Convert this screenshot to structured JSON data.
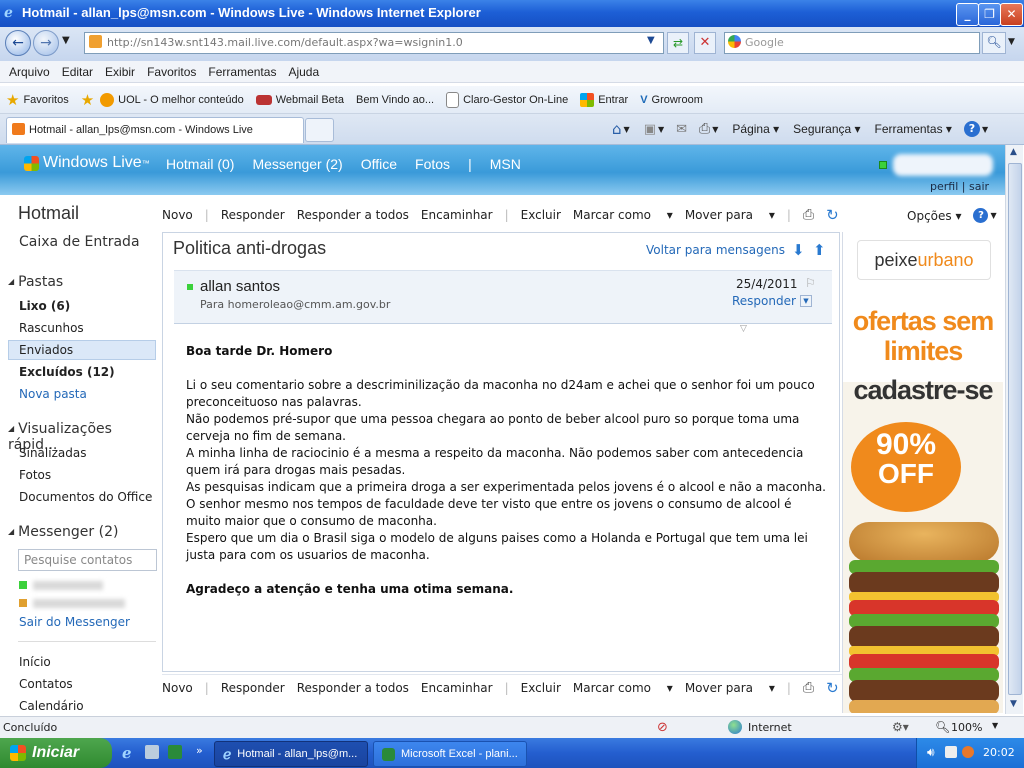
{
  "window": {
    "title": "Hotmail - allan_lps@msn.com - Windows Live - Windows Internet Explorer"
  },
  "address_bar": {
    "url": "http://sn143w.snt143.mail.live.com/default.aspx?wa=wsignin1.0",
    "search_placeholder": "Google"
  },
  "menu": [
    "Arquivo",
    "Editar",
    "Exibir",
    "Favoritos",
    "Ferramentas",
    "Ajuda"
  ],
  "favorites": {
    "label": "Favoritos",
    "items": [
      "UOL - O melhor conteúdo",
      "Webmail Beta",
      "Bem Vindo ao...",
      "Claro-Gestor On-Line",
      "Entrar",
      "Growroom"
    ]
  },
  "tab": {
    "title": "Hotmail - allan_lps@msn.com - Windows Live"
  },
  "command_bar": {
    "page": "Página",
    "security": "Segurança",
    "tools": "Ferramentas"
  },
  "wl_header": {
    "brand": "Windows Live",
    "tm": "™",
    "nav": [
      "Hotmail (0)",
      "Messenger (2)",
      "Office",
      "Fotos",
      "MSN"
    ],
    "nav_sep": "|",
    "profile": "perfil",
    "profile_sep": "|",
    "signout": "sair"
  },
  "sidebar": {
    "title": "Hotmail",
    "inbox": "Caixa de Entrada",
    "folders_head": "Pastas",
    "folders": [
      "Lixo (6)",
      "Rascunhos",
      "Enviados",
      "Excluídos (12)",
      "Nova pasta"
    ],
    "quick_head": "Visualizações rápid...",
    "quick": [
      "Sinalizadas",
      "Fotos",
      "Documentos do Office"
    ],
    "messenger_head": "Messenger (2)",
    "contacts_placeholder": "Pesquise contatos",
    "signout_messenger": "Sair do Messenger",
    "bottom": [
      "Início",
      "Contatos",
      "Calendário"
    ]
  },
  "toolbar": {
    "new": "Novo",
    "reply": "Responder",
    "reply_all": "Responder a todos",
    "forward": "Encaminhar",
    "delete": "Excluir",
    "mark_as": "Marcar como",
    "move_to": "Mover para",
    "options": "Opções"
  },
  "message": {
    "subject": "Politica anti-drogas",
    "back": "Voltar para mensagens",
    "sender": "allan santos",
    "to": "Para homeroleao@cmm.am.gov.br",
    "date": "25/4/2011",
    "reply": "Responder",
    "greeting": "Boa tarde Dr. Homero",
    "paragraphs": [
      "Li o seu comentario sobre a descriminilização da maconha no d24am e achei que o senhor foi um pouco preconceituoso nas palavras.",
      "Não podemos pré-supor que uma pessoa chegara ao ponto de beber alcool puro so porque toma uma cerveja no fim de semana.",
      "A minha linha de raciocinio é a mesma a respeito da maconha. Não podemos saber com antecedencia quem irá para drogas mais pesadas.",
      "As pesquisas indicam que a primeira droga a ser experimentada pelos jovens é o alcool e não a maconha.",
      "O senhor mesmo nos tempos de faculdade deve ter visto que entre os jovens o consumo de alcool é muito maior que o consumo de maconha.",
      "Espero que um dia o Brasil siga o modelo de alguns paises como a Holanda e Portugal que tem uma lei justa para com os usuarios de maconha."
    ],
    "closing": "Agradeço a atenção e tenha uma otima semana."
  },
  "ad": {
    "brand_a": "peixe",
    "brand_b": "urbano",
    "line1": "ofertas sem",
    "line2": "limites",
    "cta": "cadastre-se",
    "discount": "90%",
    "off": "OFF"
  },
  "status_bar": {
    "status": "Concluído",
    "zone": "Internet",
    "zoom": "100%"
  },
  "taskbar": {
    "start": "Iniciar",
    "tasks": [
      "Hotmail - allan_lps@m...",
      "Microsoft Excel - plani..."
    ],
    "clock": "20:02"
  },
  "colors": {
    "accent": "#2469b8",
    "header_blue": "#3a9ad9",
    "ad_orange": "#f08a1c",
    "taskbar": "#245ecf",
    "start_green": "#2f8a2f"
  }
}
